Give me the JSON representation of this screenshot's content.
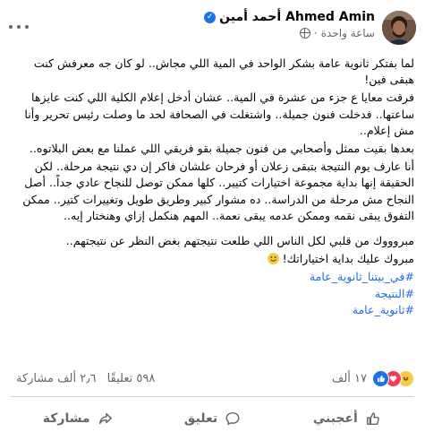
{
  "post": {
    "author": "Ahmed Amin أحمد أمين",
    "time": "ساعة واحدة",
    "content": [
      "لما بفتكر ثانوية عامة بشكر الواحد في المية اللي مجاش.. لو كان جه معرفش كنت هبقى فين!",
      "فرقت معايا ع جزء من عشرة في المية.. عشان أدخل إعلام الكلية اللي كنت عايزها ساعتها.. فدخلت فنون جميلة.. واشتغلت في الصحافة لحد ما وصلت رئيس تحرير وأنا مش إعلام..",
      "بعدها بقيت ممثل وأصحابي من فنون جميلة بقو فريقي اللي عملنا مع بعض البلاتوه..",
      "أنا عارف يوم النتيجة بتبقى زعلان أو فرحان علشان فاكر إن دي نتيجة مرحلة.. لكن الحقيقة إنها بداية مجموعة اختيارات كتيير.. كلها ممكن توصل للنجاح عادي جداً.. أصل النجاح مش مرحلة من الدراسة..  ده مشوار كبير وطريق طويل وتغييرات كتير.. ممكن التفوق يبقى نقمه وممكن عدمه يبقى نعمة.. المهم هنكمل إزاي وهنختار إيه..",
      "مبروووك من قلبي لكل الناس اللي طلعت نتيجتهم بغض النظر عن نتيجتهم..",
      "مبروك عليك بداية اختياراتك!"
    ],
    "hashtags": [
      "#في_بيتنا_ثانوية_عامة",
      "#النتيجة",
      "#ثانوية_عامة"
    ]
  },
  "stats": {
    "reactions": "١٧ ألف",
    "comments": "٥٩٨ تعليقًا",
    "shares": "٢٫٦ ألف مشاركة"
  },
  "actions": {
    "like": "أعجبني",
    "comment": "تعليق",
    "share": "مشاركة"
  },
  "colors": {
    "link": "#216fdb",
    "secondary_text": "#65676b",
    "like_blue": "#1b74e4",
    "love_red": "#f33e58",
    "haha_yellow": "#f7c948"
  },
  "icons": [
    "more-options-icon",
    "verified-badge-icon",
    "globe-icon",
    "like-reaction-icon",
    "love-reaction-icon",
    "haha-reaction-icon",
    "like-icon",
    "comment-icon",
    "share-icon",
    "smile-emoji-icon"
  ]
}
